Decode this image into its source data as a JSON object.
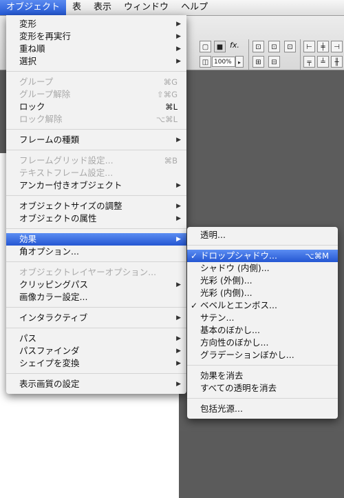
{
  "menubar": {
    "items": [
      {
        "label": "オブジェクト",
        "active": true
      },
      {
        "label": "表",
        "active": false
      },
      {
        "label": "表示",
        "active": false
      },
      {
        "label": "ウィンドウ",
        "active": false
      },
      {
        "label": "ヘルプ",
        "active": false
      }
    ]
  },
  "toolbar": {
    "zoom_value": "100%",
    "fx_label": "fx."
  },
  "main_menu": {
    "groups": [
      [
        {
          "label": "変形",
          "submenu": true
        },
        {
          "label": "変形を再実行",
          "submenu": true
        },
        {
          "label": "重ね順",
          "submenu": true
        },
        {
          "label": "選択",
          "submenu": true
        }
      ],
      [
        {
          "label": "グループ",
          "shortcut": "⌘G",
          "disabled": true
        },
        {
          "label": "グループ解除",
          "shortcut": "⇧⌘G",
          "disabled": true
        },
        {
          "label": "ロック",
          "shortcut": "⌘L"
        },
        {
          "label": "ロック解除",
          "shortcut": "⌥⌘L",
          "disabled": true
        }
      ],
      [
        {
          "label": "フレームの種類",
          "submenu": true
        }
      ],
      [
        {
          "label": "フレームグリッド設定...",
          "shortcut": "⌘B",
          "disabled": true
        },
        {
          "label": "テキストフレーム設定...",
          "disabled": true
        },
        {
          "label": "アンカー付きオブジェクト",
          "submenu": true
        }
      ],
      [
        {
          "label": "オブジェクトサイズの調整",
          "submenu": true
        },
        {
          "label": "オブジェクトの属性",
          "submenu": true
        }
      ],
      [
        {
          "label": "効果",
          "submenu": true,
          "highlighted": true
        },
        {
          "label": "角オプション..."
        }
      ],
      [
        {
          "label": "オブジェクトレイヤーオプション...",
          "disabled": true
        },
        {
          "label": "クリッピングパス",
          "submenu": true
        },
        {
          "label": "画像カラー設定..."
        }
      ],
      [
        {
          "label": "インタラクティブ",
          "submenu": true
        }
      ],
      [
        {
          "label": "パス",
          "submenu": true
        },
        {
          "label": "パスファインダ",
          "submenu": true
        },
        {
          "label": "シェイプを変換",
          "submenu": true
        }
      ],
      [
        {
          "label": "表示画質の設定",
          "submenu": true
        }
      ]
    ]
  },
  "effects_submenu": {
    "groups": [
      [
        {
          "label": "透明..."
        }
      ],
      [
        {
          "label": "ドロップシャドウ...",
          "shortcut": "⌥⌘M",
          "checked": true,
          "highlighted": true
        },
        {
          "label": "シャドウ (内側)..."
        },
        {
          "label": "光彩 (外側)..."
        },
        {
          "label": "光彩 (内側)..."
        },
        {
          "label": "ベベルとエンボス...",
          "checked": true
        },
        {
          "label": "サテン..."
        },
        {
          "label": "基本のぼかし..."
        },
        {
          "label": "方向性のぼかし..."
        },
        {
          "label": "グラデーションぼかし..."
        }
      ],
      [
        {
          "label": "効果を消去"
        },
        {
          "label": "すべての透明を消去"
        }
      ],
      [
        {
          "label": "包括光源..."
        }
      ]
    ]
  },
  "icons": {
    "checkmark": "✓",
    "submenu_arrow": "▶"
  }
}
